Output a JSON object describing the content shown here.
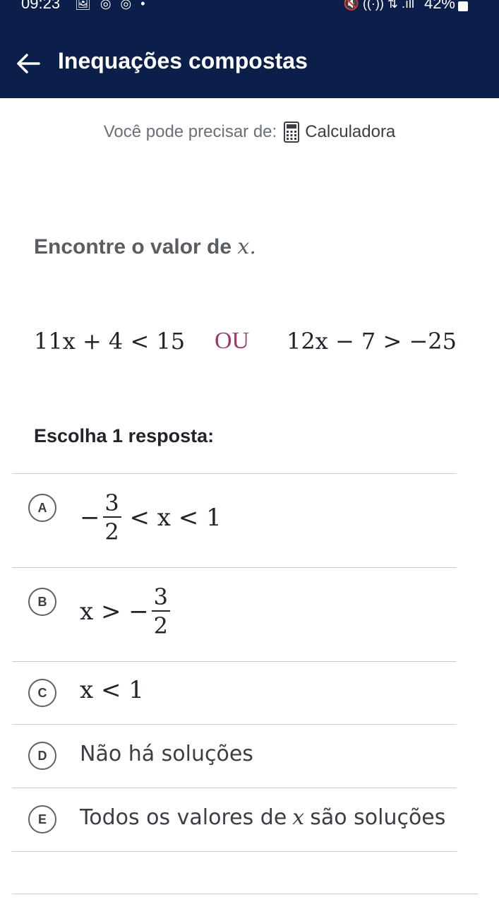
{
  "status_bar": {
    "time": "09:23",
    "notif_icons": "🖼 ◎ ◎ •",
    "system_icons": "🔇 ((·)) ⇅ .ıll",
    "battery": "42%"
  },
  "app_bar": {
    "title": "Inequações compostas"
  },
  "hint": {
    "prefix": "Você pode precisar de:",
    "tool": "Calculadora"
  },
  "question": {
    "prompt": "Encontre o valor de",
    "variable": "x",
    "period": ".",
    "left_inequality": "11x + 4 < 15",
    "connector": "OU",
    "right_inequality": "12x − 7 > −25"
  },
  "choose_label": "Escolha 1 resposta:",
  "options": [
    {
      "letter": "A",
      "minus": "−",
      "num": "3",
      "den": "2",
      "tail": "< x < 1"
    },
    {
      "letter": "B",
      "head": "x > −",
      "num": "3",
      "den": "2"
    },
    {
      "letter": "C",
      "expr": "x < 1"
    },
    {
      "letter": "D",
      "text": "Não há soluções"
    },
    {
      "letter": "E",
      "text_before": "Todos os valores de",
      "variable": "x",
      "text_after": "são soluções"
    }
  ]
}
